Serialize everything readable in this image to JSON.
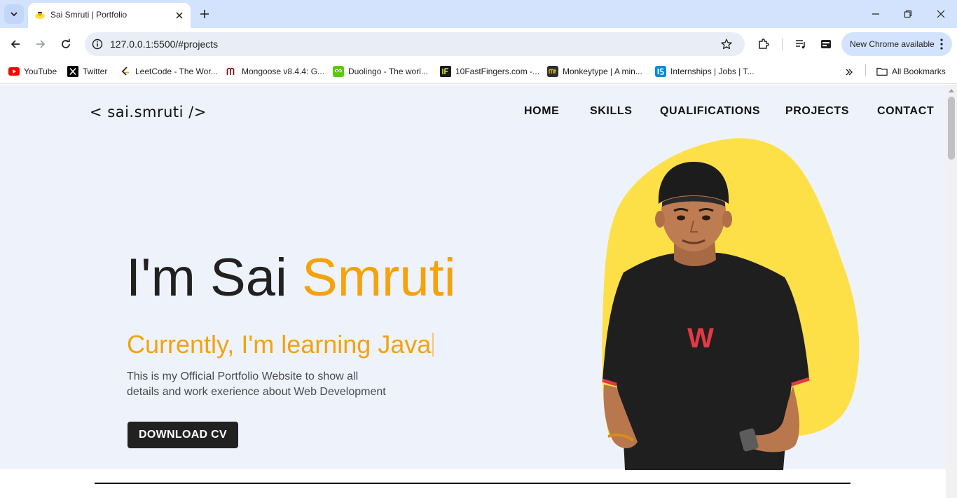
{
  "browser": {
    "tab": {
      "title": "Sai Smruti | Portfolio"
    },
    "url": "127.0.0.1:5500/#projects",
    "update_label": "New Chrome available",
    "bookmarks": [
      {
        "label": "YouTube",
        "icon": "youtube-icon"
      },
      {
        "label": "Twitter",
        "icon": "x-twitter-icon"
      },
      {
        "label": "LeetCode - The Wor...",
        "icon": "leetcode-icon"
      },
      {
        "label": "Mongoose v8.4.4: G...",
        "icon": "mongoose-icon"
      },
      {
        "label": "Duolingo - The worl...",
        "icon": "duolingo-icon"
      },
      {
        "label": "10FastFingers.com -...",
        "icon": "10fastfingers-icon"
      },
      {
        "label": "Monkeytype | A min...",
        "icon": "monkeytype-icon"
      },
      {
        "label": "Internships | Jobs | T...",
        "icon": "internshala-icon"
      }
    ],
    "all_bookmarks_label": "All Bookmarks"
  },
  "page": {
    "logo": "< sai.smruti />",
    "nav": [
      "HOME",
      "SKILLS",
      "QUALIFICATIONS",
      "PROJECTS",
      "CONTACT"
    ],
    "hero": {
      "greeting": "I'm Sai",
      "name_accent": "Smruti",
      "typing_text": "Currently, I'm learning Java",
      "description_line1": "This is my Official Portfolio Website to show all",
      "description_line2": "details and work exerience about Web Development",
      "cta": "DOWNLOAD CV",
      "shirt_logo": "W"
    },
    "colors": {
      "accent": "#f5a20e",
      "blob": "#fde047",
      "hero_bg": "#eef3fb",
      "button_bg": "#212121"
    }
  }
}
